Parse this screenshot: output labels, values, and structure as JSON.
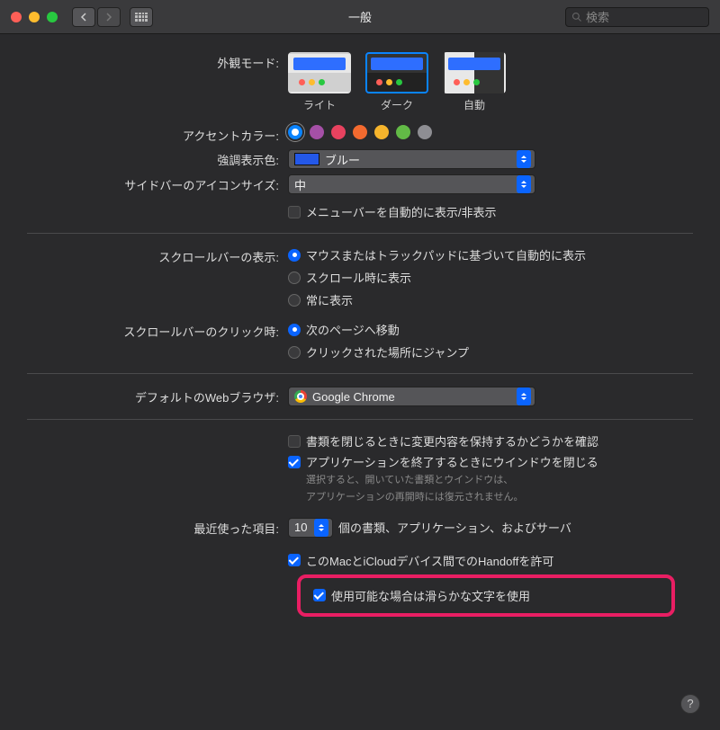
{
  "window": {
    "title": "一般"
  },
  "search": {
    "placeholder": "検索"
  },
  "labels": {
    "appearance": "外観モード:",
    "accent": "アクセントカラー:",
    "highlight": "強調表示色:",
    "sidebarIcon": "サイドバーのアイコンサイズ:",
    "scrollShow": "スクロールバーの表示:",
    "scrollClick": "スクロールバーのクリック時:",
    "browser": "デフォルトのWebブラウザ:",
    "recent": "最近使った項目:"
  },
  "appearance": {
    "options": [
      {
        "key": "light",
        "label": "ライト",
        "selected": false
      },
      {
        "key": "dark",
        "label": "ダーク",
        "selected": true
      },
      {
        "key": "auto",
        "label": "自動",
        "selected": false
      }
    ]
  },
  "accent": {
    "colors": [
      "#0a84ff",
      "#a550a7",
      "#e8425f",
      "#f36a2f",
      "#f6b42c",
      "#62ba46",
      "#8e8e93"
    ],
    "selectedIndex": 0
  },
  "highlight": {
    "value": "ブルー"
  },
  "sidebarIcon": {
    "value": "中"
  },
  "menubarAutoHide": {
    "checked": false,
    "label": "メニューバーを自動的に表示/非表示"
  },
  "scrollShow": {
    "options": [
      "マウスまたはトラックパッドに基づいて自動的に表示",
      "スクロール時に表示",
      "常に表示"
    ],
    "selectedIndex": 0
  },
  "scrollClick": {
    "options": [
      "次のページへ移動",
      "クリックされた場所にジャンプ"
    ],
    "selectedIndex": 0
  },
  "browser": {
    "value": "Google Chrome"
  },
  "docOptions": {
    "askChanges": {
      "checked": false,
      "label": "書類を閉じるときに変更内容を保持するかどうかを確認"
    },
    "closeWindows": {
      "checked": true,
      "label": "アプリケーションを終了するときにウインドウを閉じる"
    },
    "hint1": "選択すると、開いていた書類とウインドウは、",
    "hint2": "アプリケーションの再開時には復元されません。"
  },
  "recent": {
    "value": "10",
    "suffix": "個の書類、アプリケーション、およびサーバ"
  },
  "handoff": {
    "checked": true,
    "label": "このMacとiCloudデバイス間でのHandoffを許可"
  },
  "fontSmoothing": {
    "checked": true,
    "label": "使用可能な場合は滑らかな文字を使用"
  },
  "help": "?"
}
